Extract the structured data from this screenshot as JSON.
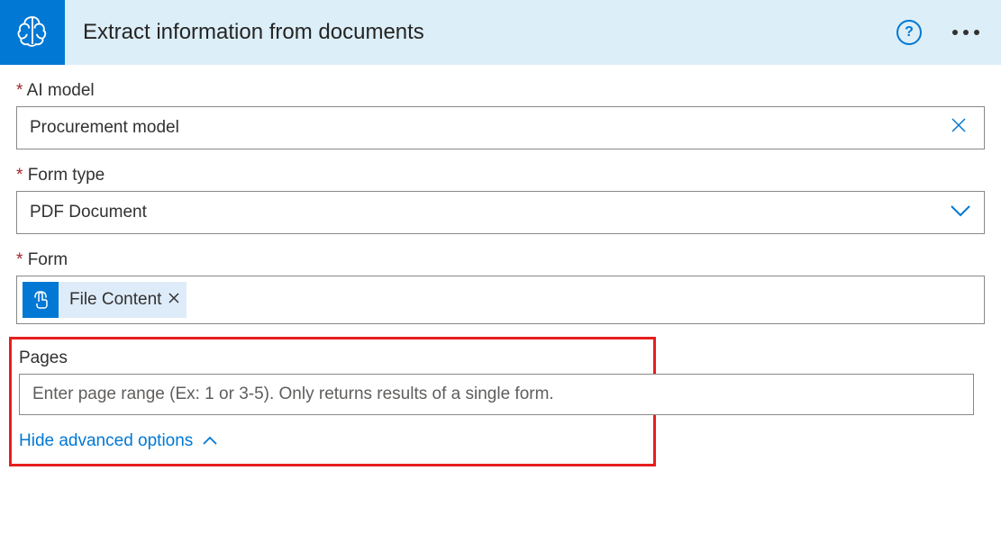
{
  "header": {
    "title": "Extract information from documents"
  },
  "fields": {
    "ai_model": {
      "label": "AI model",
      "value": "Procurement model"
    },
    "form_type": {
      "label": "Form type",
      "value": "PDF Document"
    },
    "form": {
      "label": "Form",
      "token_label": "File Content"
    },
    "pages": {
      "label": "Pages",
      "placeholder": "Enter page range (Ex: 1 or 3-5). Only returns results of a single form."
    }
  },
  "toggle_label": "Hide advanced options"
}
